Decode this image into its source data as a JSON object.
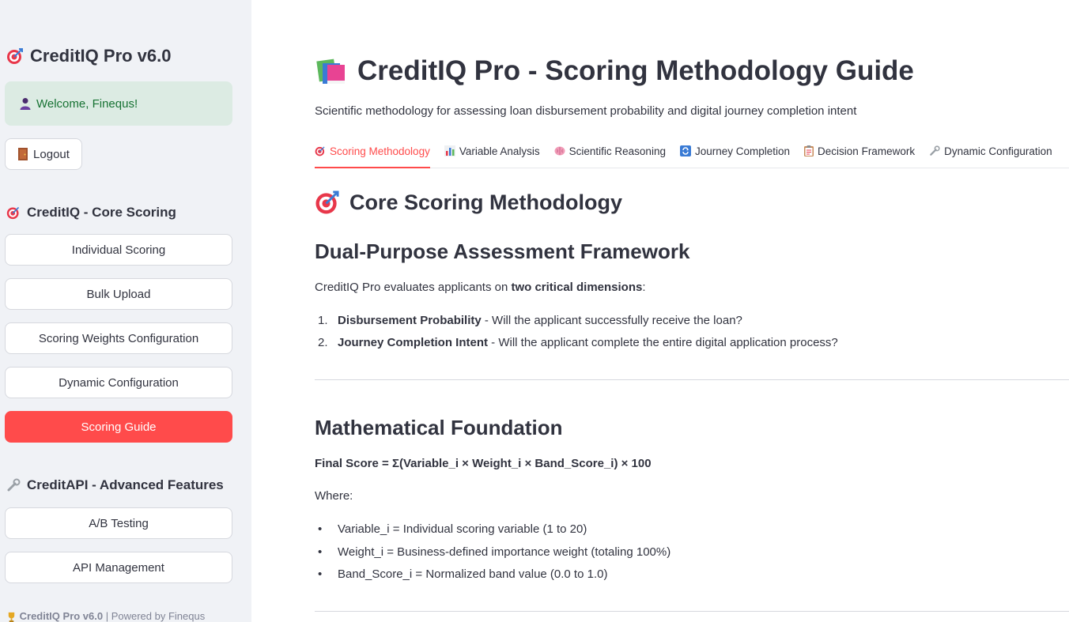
{
  "sidebar": {
    "app_title": "CreditIQ Pro v6.0",
    "welcome": "Welcome, Finequs!",
    "logout_label": "Logout",
    "core_section_title": "CreditIQ - Core Scoring",
    "core_items": [
      {
        "label": "Individual Scoring"
      },
      {
        "label": "Bulk Upload"
      },
      {
        "label": "Scoring Weights Configuration"
      },
      {
        "label": "Dynamic Configuration"
      },
      {
        "label": "Scoring Guide"
      }
    ],
    "advanced_section_title": "CreditAPI - Advanced Features",
    "advanced_items": [
      {
        "label": "A/B Testing"
      },
      {
        "label": "API Management"
      }
    ],
    "footer_app": "CreditIQ Pro v6.0",
    "footer_powered": " | Powered by Finequs"
  },
  "main": {
    "page_title": "CreditIQ Pro - Scoring Methodology Guide",
    "subtitle": "Scientific methodology for assessing loan disbursement probability and digital journey completion intent",
    "tabs": [
      {
        "label": "Scoring Methodology",
        "icon": "target-icon"
      },
      {
        "label": "Variable Analysis",
        "icon": "bar-chart-icon"
      },
      {
        "label": "Scientific Reasoning",
        "icon": "brain-icon"
      },
      {
        "label": "Journey Completion",
        "icon": "cycle-icon"
      },
      {
        "label": "Decision Framework",
        "icon": "clipboard-icon"
      },
      {
        "label": "Dynamic Configuration",
        "icon": "wrench-icon"
      }
    ],
    "section_heading": "Core Scoring Methodology",
    "framework_heading": "Dual-Purpose Assessment Framework",
    "framework_intro_pre": "CreditIQ Pro evaluates applicants on ",
    "framework_intro_bold": "two critical dimensions",
    "framework_intro_post": ":",
    "dimensions": [
      {
        "num": "1.",
        "bold": "Disbursement Probability",
        "text": " - Will the applicant successfully receive the loan?"
      },
      {
        "num": "2.",
        "bold": "Journey Completion Intent",
        "text": " - Will the applicant complete the entire digital application process?"
      }
    ],
    "math_heading": "Mathematical Foundation",
    "formula": "Final Score = Σ(Variable_i × Weight_i × Band_Score_i) × 100",
    "where_label": "Where:",
    "definitions": [
      "Variable_i = Individual scoring variable (1 to 20)",
      "Weight_i = Business-defined importance weight (totaling 100%)",
      "Band_Score_i = Normalized band value (0.0 to 1.0)"
    ]
  },
  "colors": {
    "accent": "#ff4b4b",
    "sidebar_bg": "#f0f2f6",
    "success_bg": "#dcebe3",
    "success_text": "#177233"
  }
}
